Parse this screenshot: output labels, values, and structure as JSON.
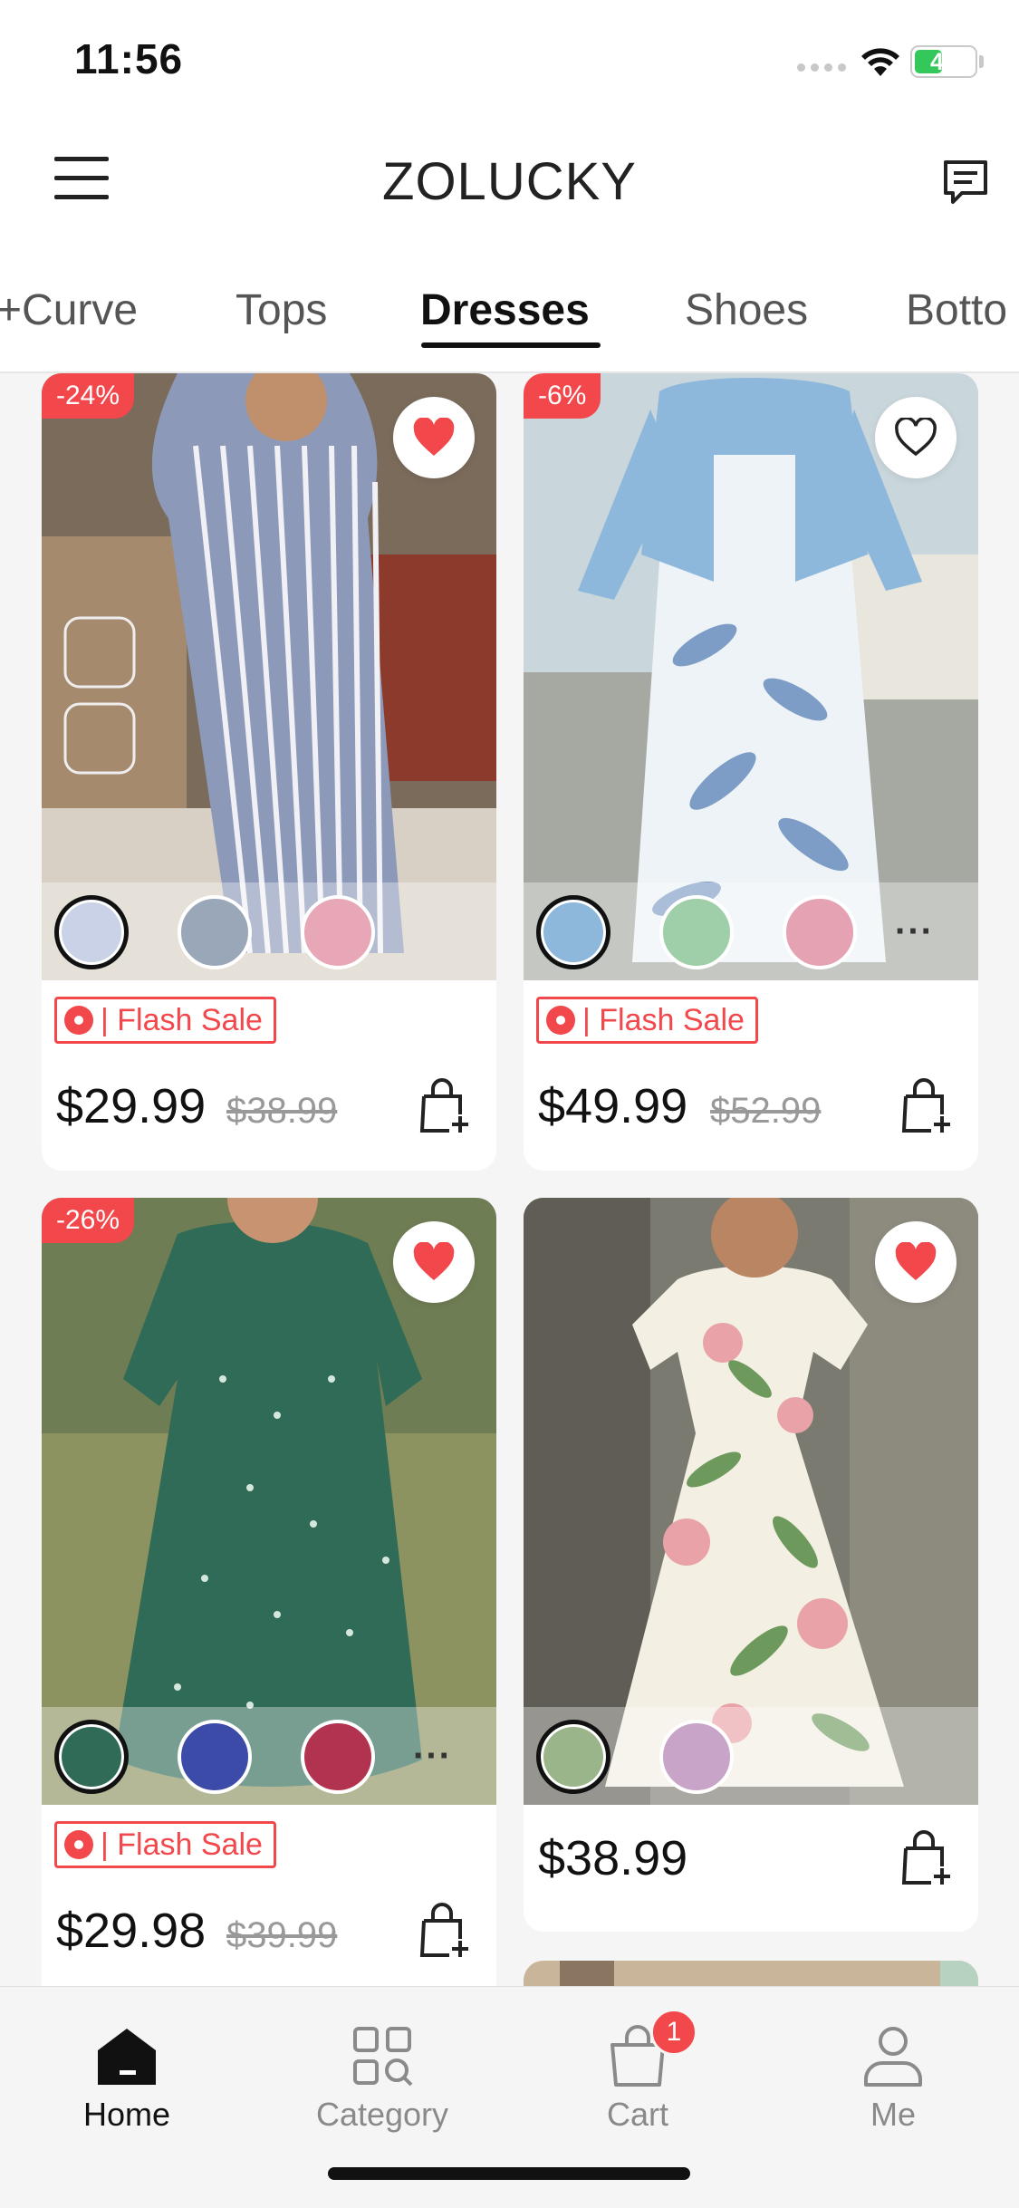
{
  "status_bar": {
    "time": "11:56",
    "battery": "43"
  },
  "header": {
    "title": "ZOLUCKY"
  },
  "tabs": [
    {
      "label": "+Curve"
    },
    {
      "label": "Tops"
    },
    {
      "label": "Dresses",
      "active": true
    },
    {
      "label": "Shoes"
    },
    {
      "label": "Botto"
    }
  ],
  "products": [
    {
      "discount": "-24%",
      "favorited": true,
      "flash_label": "Flash Sale",
      "price": "$29.99",
      "original_price": "$38.99",
      "more_colors": false
    },
    {
      "discount": "-6%",
      "favorited": false,
      "flash_label": "Flash Sale",
      "price": "$49.99",
      "original_price": "$52.99",
      "more_colors": true,
      "more_label": "···"
    },
    {
      "discount": "-26%",
      "favorited": true,
      "flash_label": "Flash Sale",
      "price": "$29.98",
      "original_price": "$39.99",
      "more_colors": true,
      "more_label": "···"
    },
    {
      "discount": "",
      "favorited": true,
      "price": "$38.99"
    }
  ],
  "bottom_nav": [
    {
      "label": "Home",
      "icon": "home-icon",
      "active": true
    },
    {
      "label": "Category",
      "icon": "category-icon"
    },
    {
      "label": "Cart",
      "icon": "cart-icon",
      "badge": "1"
    },
    {
      "label": "Me",
      "icon": "person-icon"
    }
  ],
  "colors": {
    "accent": "#f2474b",
    "battery": "#34c759"
  }
}
